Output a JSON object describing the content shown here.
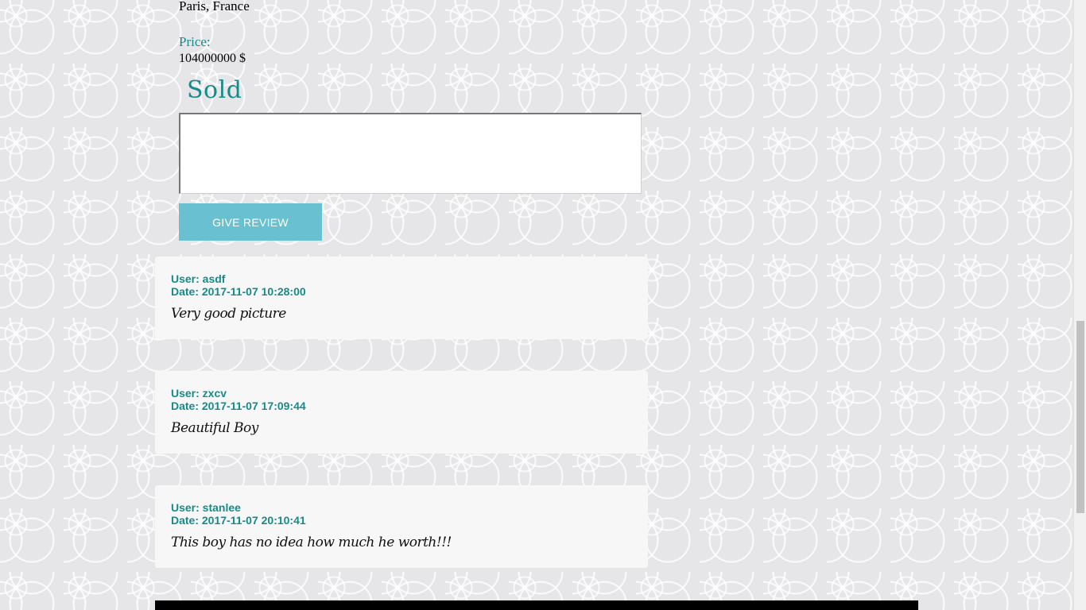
{
  "listing": {
    "location": "Paris, France",
    "price_label": "Price:",
    "price_value": "104000000 $",
    "status": "Sold"
  },
  "review_form": {
    "placeholder": "",
    "button_label": "GIVE REVIEW"
  },
  "reviews": [
    {
      "user": "User: asdf",
      "date": "Date: 2017-11-07 10:28:00",
      "text": "Very good picture"
    },
    {
      "user": "User: zxcv",
      "date": "Date: 2017-11-07 17:09:44",
      "text": "Beautiful Boy"
    },
    {
      "user": "User: stanlee",
      "date": "Date: 2017-11-07 20:10:41",
      "text": "This boy has no idea how much he worth!!!"
    }
  ],
  "colors": {
    "accent": "#178a8a",
    "button": "#68c0d0",
    "card": "#f7f7f7",
    "footer": "#000000"
  }
}
